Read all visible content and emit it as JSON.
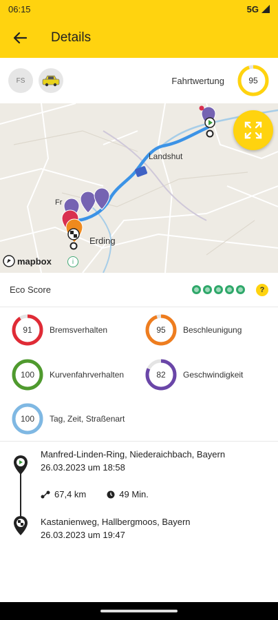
{
  "status_bar": {
    "time": "06:15",
    "network": "5G"
  },
  "app_bar": {
    "title": "Details"
  },
  "header": {
    "driver_initials": "FS",
    "rating_label": "Fahrtwertung",
    "rating_value": "95",
    "rating_fraction": 0.95
  },
  "map": {
    "place_labels": [
      "Landshut",
      "Erding",
      "Fr"
    ],
    "attribution": "mapbox"
  },
  "eco": {
    "label": "Eco Score",
    "leaves": 5,
    "help_label": "?"
  },
  "scores": [
    {
      "value": "91",
      "label": "Bremsverhalten",
      "fraction": 0.91,
      "color": "#e02b36"
    },
    {
      "value": "95",
      "label": "Beschleunigung",
      "fraction": 0.95,
      "color": "#ee7d1f"
    },
    {
      "value": "100",
      "label": "Kurvenfahrverhalten",
      "fraction": 1.0,
      "color": "#4f9a2e"
    },
    {
      "value": "82",
      "label": "Geschwindigkeit",
      "fraction": 0.82,
      "color": "#6a46a8"
    },
    {
      "value": "100",
      "label": "Tag, Zeit, Straßenart",
      "fraction": 1.0,
      "color": "#7fb8e3"
    }
  ],
  "trip": {
    "start_address": "Manfred-Linden-Ring, Niederaichbach, Bayern",
    "start_time": "26.03.2023 um 18:58",
    "distance": "67,4 km",
    "duration": "49 Min.",
    "end_address": "Kastanienweg, Hallbergmoos, Bayern",
    "end_time": "26.03.2023 um 19:47"
  }
}
